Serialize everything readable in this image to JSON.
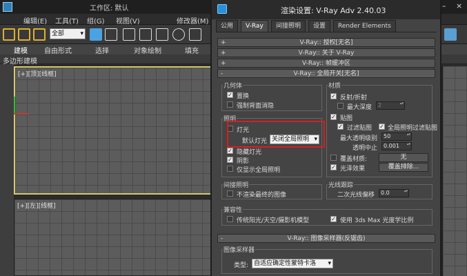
{
  "max_window": {
    "title_workspace_label": "工作区: 默认",
    "menu": [
      "编辑(E)",
      "工具(T)",
      "组(G)",
      "视图(V)",
      "修改器(M)"
    ],
    "toolbar_selection": "全部",
    "ribbon_tabs": [
      "建模",
      "自由形式",
      "选择",
      "对象绘制",
      "填充"
    ],
    "ribbon_sub_label": "多边形建模",
    "viewport_top_label": "[+][顶][线框]",
    "viewport_front_label": "[+][左][线框]",
    "controls": [
      "–",
      "×"
    ]
  },
  "dialog": {
    "title": "渲染设置: V-Ray Adv 2.40.03",
    "tabs": [
      "公用",
      "V-Ray",
      "间接照明",
      "设置",
      "Render Elements"
    ],
    "active_tab": "V-Ray",
    "rollouts_collapsed": [
      "V-Ray:: 授权[无名]",
      "V-Ray:: 关于 V-Ray",
      "V-Ray:: 帧缓冲区"
    ],
    "global_switches": {
      "header": "V-Ray:: 全局开关[无名]",
      "geometry": {
        "title": "几何体",
        "displacement": "置换",
        "force_backface": "强制背面消隐"
      },
      "materials": {
        "title": "材质",
        "reflect_refract": "反射/折射",
        "max_depth_label": "最大深度",
        "max_depth_value": "2",
        "maps": "贴图",
        "filter_maps": "过滤贴图",
        "gi_filter_maps": "全局照明过滤贴图",
        "max_transp_label": "最大透明级别",
        "max_transp_value": "50",
        "transp_cutoff_label": "透明中止",
        "transp_cutoff_value": "0.001",
        "override_mtl": "覆盖材质:",
        "override_mtl_btn": "无",
        "glossy": "光泽效果",
        "override_exclude_btn": "覆盖排除..."
      },
      "lighting": {
        "title": "照明",
        "lights": "灯光",
        "default_lights_label": "默认灯光",
        "default_lights_value": "关闭全局照明",
        "hidden_lights": "隐藏灯光",
        "shadows": "阴影",
        "gi_only": "仅显示全局照明"
      },
      "indirect": {
        "title": "间接照明",
        "dont_render_final": "不渲染最终的图像"
      },
      "raytracing": {
        "title": "光线跟踪",
        "secondary_bias": "二次光线偏移",
        "secondary_bias_value": "0.0"
      },
      "compatibility": {
        "title": "兼容性",
        "legacy_sun": "传统阳光/天空/摄影机模型",
        "use_3dsmax": "使用 3ds Max 光度学比例"
      }
    },
    "image_sampler": {
      "header": "V-Ray:: 图像采样器(反锯齿)",
      "group_title": "图像采样器",
      "type_label": "类型:",
      "type_value": "自适应确定性蒙特卡洛"
    }
  }
}
